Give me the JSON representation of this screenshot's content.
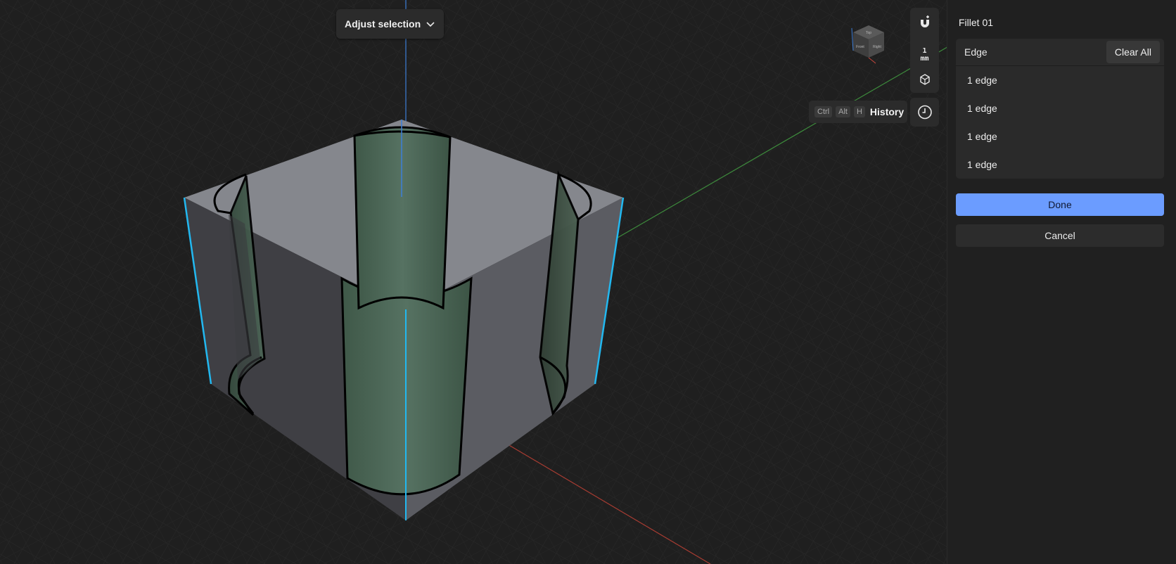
{
  "viewport": {
    "selection_dropdown": "Adjust selection",
    "unit": {
      "value": "1",
      "unit": "mm"
    },
    "history_hint": {
      "keys": [
        "Ctrl",
        "Alt",
        "H"
      ],
      "label": "History"
    },
    "view_cube_faces": [
      "Top",
      "Front",
      "Right"
    ],
    "axis_colors": {
      "x": "#c8463c",
      "y": "#4ea84a",
      "z": "#3d7fd8"
    },
    "selection_color": "#22b8f0"
  },
  "panel": {
    "title": "Fillet 01",
    "edge_section_label": "Edge",
    "clear_label": "Clear All",
    "edges": [
      "1 edge",
      "1 edge",
      "1 edge",
      "1 edge"
    ],
    "done_label": "Done",
    "cancel_label": "Cancel",
    "accent_color": "#6b9cff"
  }
}
